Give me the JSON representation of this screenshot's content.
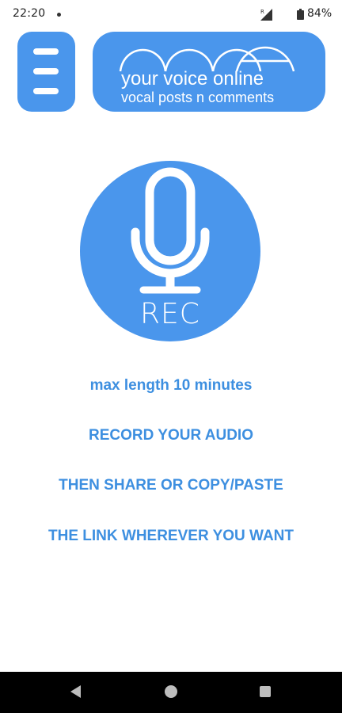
{
  "status_bar": {
    "time": "22:20",
    "battery": "84%",
    "icons": [
      "notification-dot-icon",
      "signal-icon",
      "battery-icon"
    ]
  },
  "header": {
    "menu_icon": "hamburger-menu-icon",
    "logo": {
      "tagline": "your voice online",
      "subtitle": "vocal posts n comments"
    }
  },
  "record": {
    "icon": "microphone-icon",
    "label": "REC"
  },
  "instructions": [
    "max length 10 minutes",
    "RECORD YOUR AUDIO",
    "THEN SHARE OR COPY/PASTE",
    "THE LINK WHEREVER YOU WANT"
  ],
  "navigation": {
    "icons": [
      "back-icon",
      "home-icon",
      "recents-icon"
    ]
  },
  "colors": {
    "accent": "#4a96ec",
    "instruction_text": "#3d8fe0",
    "background": "#ffffff",
    "nav_bar": "#000000"
  }
}
